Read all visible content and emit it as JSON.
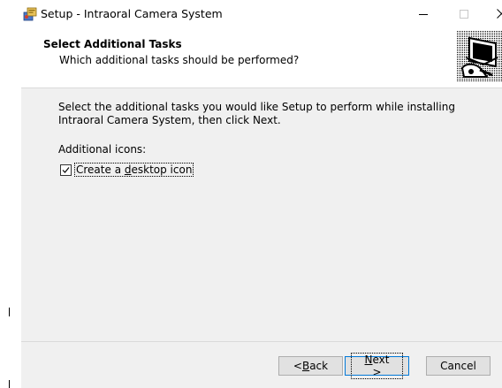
{
  "window": {
    "title": "Setup - Intraoral Camera System",
    "controls": {
      "minimize": "–",
      "maximize": "☐",
      "close": "✕"
    }
  },
  "header": {
    "title": "Select Additional Tasks",
    "subtitle": "Which additional tasks should be performed?"
  },
  "content": {
    "instructions": "Select the additional tasks you would like Setup to perform while installing Intraoral Camera System, then click Next.",
    "section_label": "Additional icons:",
    "tasks": [
      {
        "label_prefix": "Create a ",
        "label_accel": "d",
        "label_suffix": "esktop icon",
        "checked": true
      }
    ]
  },
  "footer": {
    "back": {
      "prefix": "< ",
      "accel": "B",
      "suffix": "ack"
    },
    "next": {
      "prefix": "",
      "accel": "N",
      "suffix": "ext >"
    },
    "cancel": "Cancel"
  },
  "colors": {
    "face": "#f0f0f0",
    "accent": "#0078d7"
  }
}
